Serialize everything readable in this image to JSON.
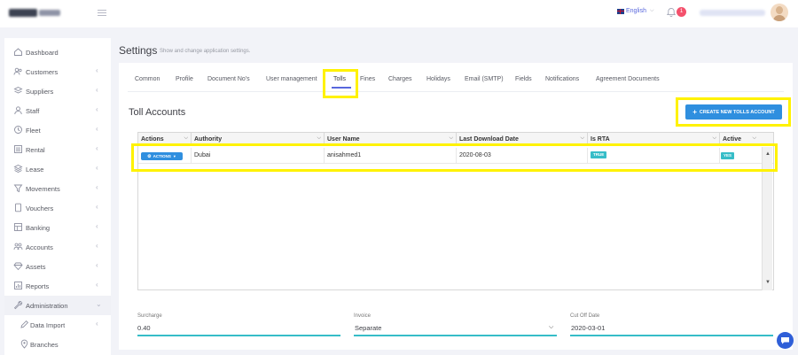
{
  "topbar": {
    "language": "English",
    "notification_count": "1"
  },
  "sidebar": {
    "items": [
      {
        "label": "Dashboard",
        "icon": "home-icon",
        "chevron": false
      },
      {
        "label": "Customers",
        "icon": "users-icon",
        "chevron": true
      },
      {
        "label": "Suppliers",
        "icon": "layers-icon",
        "chevron": true
      },
      {
        "label": "Staff",
        "icon": "user-group-icon",
        "chevron": true
      },
      {
        "label": "Fleet",
        "icon": "clock-icon",
        "chevron": true
      },
      {
        "label": "Rental",
        "icon": "list-icon",
        "chevron": true
      },
      {
        "label": "Lease",
        "icon": "stack-icon",
        "chevron": true
      },
      {
        "label": "Movements",
        "icon": "filter-icon",
        "chevron": true
      },
      {
        "label": "Vouchers",
        "icon": "document-icon",
        "chevron": true
      },
      {
        "label": "Banking",
        "icon": "bank-icon",
        "chevron": true
      },
      {
        "label": "Accounts",
        "icon": "accounts-icon",
        "chevron": true
      },
      {
        "label": "Assets",
        "icon": "diamond-icon",
        "chevron": true
      },
      {
        "label": "Reports",
        "icon": "chart-icon",
        "chevron": true
      },
      {
        "label": "Administration",
        "icon": "wrench-icon",
        "chevron": true
      },
      {
        "label": "Data Import",
        "icon": "edit-icon",
        "chevron": true
      },
      {
        "label": "Branches",
        "icon": "location-icon",
        "chevron": false
      }
    ]
  },
  "page": {
    "title": "Settings",
    "subtitle": "Show and change application settings."
  },
  "tabs": [
    "Common",
    "Profile",
    "Document No's",
    "User management",
    "Tolls",
    "Fines",
    "Charges",
    "Holidays",
    "Email (SMTP)",
    "Fields",
    "Notifications",
    "Agreement Documents"
  ],
  "active_tab": "Tolls",
  "tolls": {
    "section_title": "Toll Accounts",
    "create_button": "CREATE NEW TOLLS ACCOUNT",
    "columns": [
      "Actions",
      "Authority",
      "User Name",
      "Last Download Date",
      "Is RTA",
      "Active"
    ],
    "rows": [
      {
        "actions": "ACTIONS",
        "authority": "Dubai",
        "user_name": "anisahmed1",
        "last_download_date": "2020-08-03",
        "is_rta": "TRUE",
        "active": "YES"
      }
    ]
  },
  "form": {
    "surcharge_label": "Surcharge",
    "surcharge_value": "0.40",
    "invoice_label": "Invoice",
    "invoice_value": "Separate",
    "cutoff_label": "Cut Off Date",
    "cutoff_value": "2020-03-01"
  },
  "colors": {
    "primary": "#2f8fdf",
    "accent": "#5867dd",
    "teal": "#36bdc8",
    "badge_red": "#f4516c",
    "highlight": "#fff200"
  }
}
